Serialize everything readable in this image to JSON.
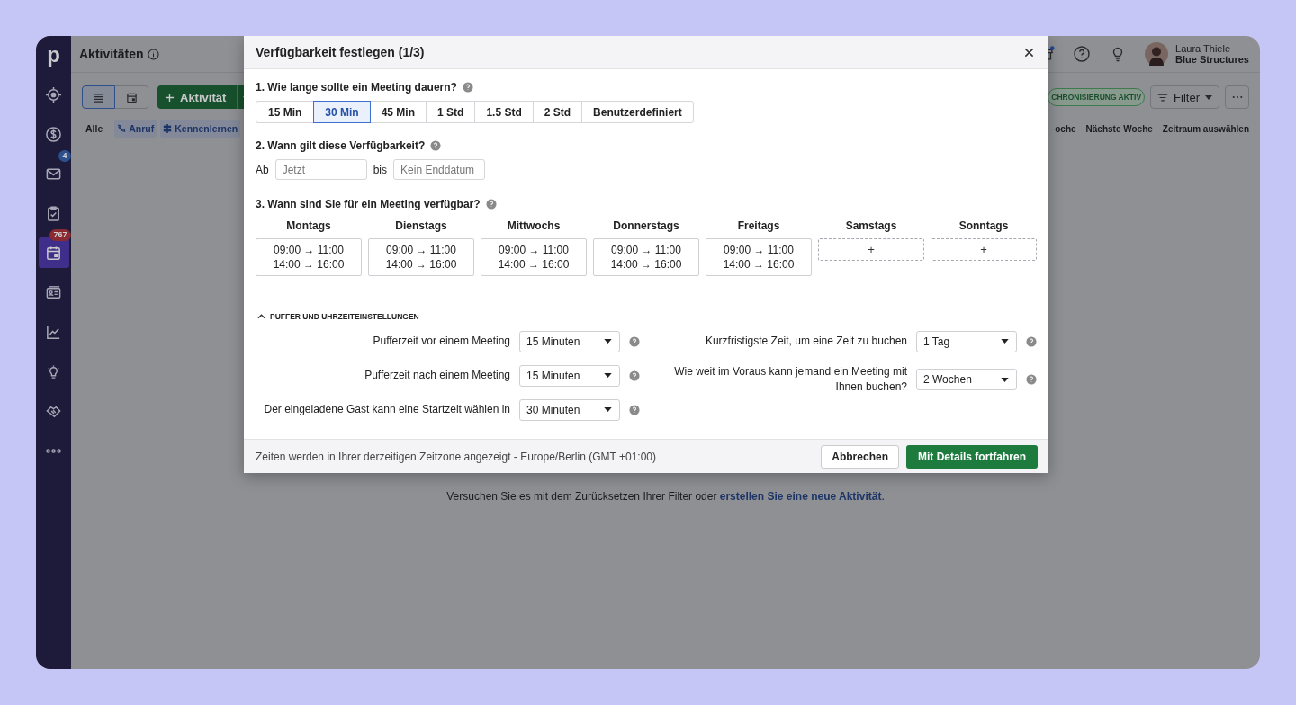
{
  "sidebar": {
    "logo": "p",
    "items": [
      {
        "kind": "target",
        "selected": false
      },
      {
        "kind": "dollar",
        "selected": false
      },
      {
        "kind": "mail",
        "selected": false,
        "badge": {
          "text": "4",
          "color": "#2c4f8e"
        }
      },
      {
        "kind": "clipboard",
        "selected": false
      },
      {
        "kind": "calendar",
        "selected": true,
        "badge": {
          "text": "767",
          "color": "#8a2a31"
        }
      },
      {
        "kind": "card",
        "selected": false
      },
      {
        "kind": "chart",
        "selected": false
      },
      {
        "kind": "bulb",
        "selected": false
      },
      {
        "kind": "handshake",
        "selected": false
      },
      {
        "kind": "more",
        "selected": false
      }
    ]
  },
  "topbar": {
    "title": "Aktivitäten",
    "user": {
      "name": "Laura Thiele",
      "company": "Blue Structures"
    }
  },
  "toolbar": {
    "views": [
      {
        "kind": "list",
        "selected": true
      },
      {
        "kind": "calendar",
        "selected": false
      }
    ],
    "add_button": "Aktivität",
    "sync_badge": "CHRONISIERUNG AKTIV",
    "filter_button": "Filter"
  },
  "type_filters": [
    {
      "label": "Alle",
      "kind": "plain"
    },
    {
      "label": "Anruf",
      "kind": "call"
    },
    {
      "label": "Kennenlernen",
      "kind": "meeting"
    }
  ],
  "periods": [
    "oche",
    "Nächste Woche",
    "Zeitraum auswählen"
  ],
  "empty_note": {
    "text": "Versuchen Sie es mit dem Zurücksetzen Ihrer Filter oder ",
    "link": "erstellen Sie eine neue Aktivität",
    "end": "."
  },
  "dialog": {
    "title": "Verfügbarkeit festlegen (1/3)",
    "duration": {
      "question": "1. Wie lange sollte ein Meeting dauern?",
      "options": [
        {
          "label": "15 Min",
          "selected": false
        },
        {
          "label": "30 Min",
          "selected": true
        },
        {
          "label": "45 Min",
          "selected": false
        },
        {
          "label": "1 Std",
          "selected": false
        },
        {
          "label": "1.5 Std",
          "selected": false
        },
        {
          "label": "2 Std",
          "selected": false
        },
        {
          "label": "Benutzerdefiniert",
          "selected": false
        }
      ]
    },
    "validity": {
      "question": "2. Wann gilt diese Verfügbarkeit?",
      "from_label": "Ab",
      "from_placeholder": "Jetzt",
      "to_label": "bis",
      "to_placeholder": "Kein Enddatum"
    },
    "availability": {
      "question": "3. Wann sind Sie für ein Meeting verfügbar?",
      "days": [
        {
          "name": "Montags",
          "slots": [
            "09:00 → 11:00",
            "14:00 → 16:00"
          ]
        },
        {
          "name": "Dienstags",
          "slots": [
            "09:00 → 11:00",
            "14:00 → 16:00"
          ]
        },
        {
          "name": "Mittwochs",
          "slots": [
            "09:00 → 11:00",
            "14:00 → 16:00"
          ]
        },
        {
          "name": "Donnerstags",
          "slots": [
            "09:00 → 11:00",
            "14:00 → 16:00"
          ]
        },
        {
          "name": "Freitags",
          "slots": [
            "09:00 → 11:00",
            "14:00 → 16:00"
          ]
        },
        {
          "name": "Samstags",
          "add": "+"
        },
        {
          "name": "Sonntags",
          "add": "+"
        }
      ]
    },
    "buffer": {
      "title": "PUFFER UND UHRZEITEINSTELLUNGEN",
      "expanded": true,
      "left": [
        {
          "label": "Pufferzeit vor einem Meeting",
          "value": "15 Minuten"
        },
        {
          "label": "Pufferzeit nach einem Meeting",
          "value": "15 Minuten"
        },
        {
          "label": "Der eingeladene Gast kann eine Startzeit wählen in",
          "value": "30 Minuten"
        }
      ],
      "right": [
        {
          "label": "Kurzfristigste Zeit, um eine Zeit zu buchen",
          "value": "1 Tag"
        },
        {
          "label": "Wie weit im Voraus kann jemand ein Meeting mit Ihnen buchen?",
          "value": "2 Wochen"
        }
      ]
    },
    "footer": {
      "note": "Zeiten werden in Ihrer derzeitigen Zeitzone angezeigt - Europe/Berlin (GMT +01:00)",
      "cancel": "Abbrechen",
      "continue": "Mit Details fortfahren"
    }
  }
}
